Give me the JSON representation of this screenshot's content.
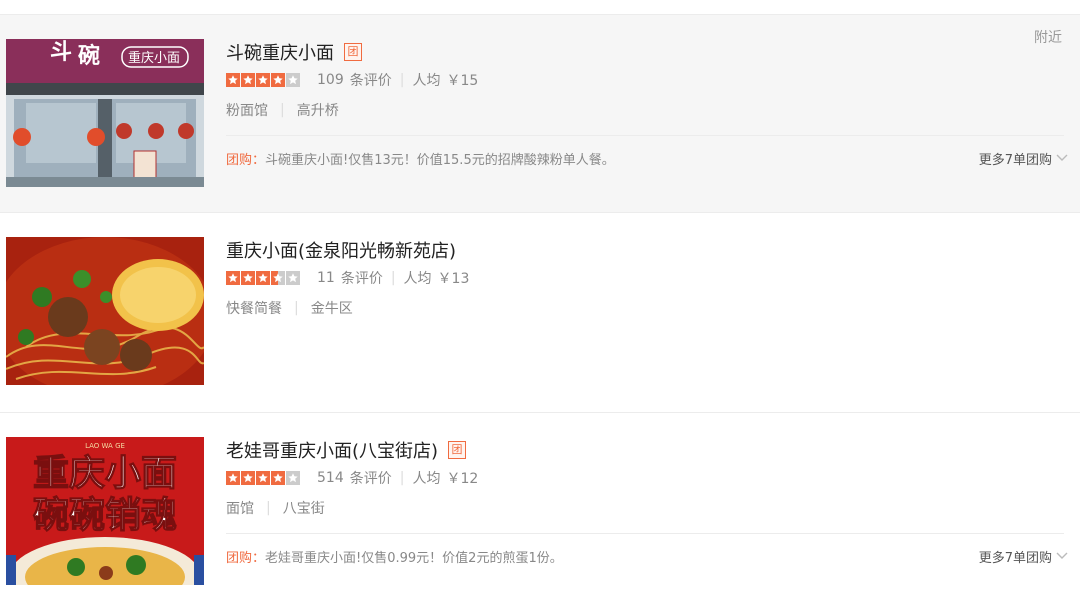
{
  "shops": [
    {
      "name": "斗碗重庆小面",
      "tuan_badge": "团",
      "rating_stars": 4,
      "review_count": "109",
      "review_unit": "条评价",
      "avg_label": "人均",
      "avg_price": "￥15",
      "category": "粉面馆",
      "area": "高升桥",
      "deal_label": "团购：",
      "deal_text": "斗碗重庆小面!仅售13元！价值15.5元的招牌酸辣粉单人餐。",
      "more_deals": "更多7单团购",
      "distance": "附近",
      "image_text": "重庆小面"
    },
    {
      "name": "重庆小面(金泉阳光畅新苑店)",
      "rating_stars": 3.5,
      "review_count": "11",
      "review_unit": "条评价",
      "avg_label": "人均",
      "avg_price": "￥13",
      "category": "快餐简餐",
      "area": "金牛区"
    },
    {
      "name": "老娃哥重庆小面(八宝街店)",
      "tuan_badge": "团",
      "rating_stars": 4,
      "review_count": "514",
      "review_unit": "条评价",
      "avg_label": "人均",
      "avg_price": "￥12",
      "category": "面馆",
      "area": "八宝街",
      "deal_label": "团购：",
      "deal_text": "老娃哥重庆小面!仅售0.99元！价值2元的煎蛋1份。",
      "more_deals": "更多7单团购",
      "image_text_line1": "重庆小面",
      "image_text_line2": "碗碗销魂"
    }
  ],
  "colors": {
    "star_on": "#f06b40",
    "star_off": "#cccccc",
    "accent": "#f06b40"
  }
}
